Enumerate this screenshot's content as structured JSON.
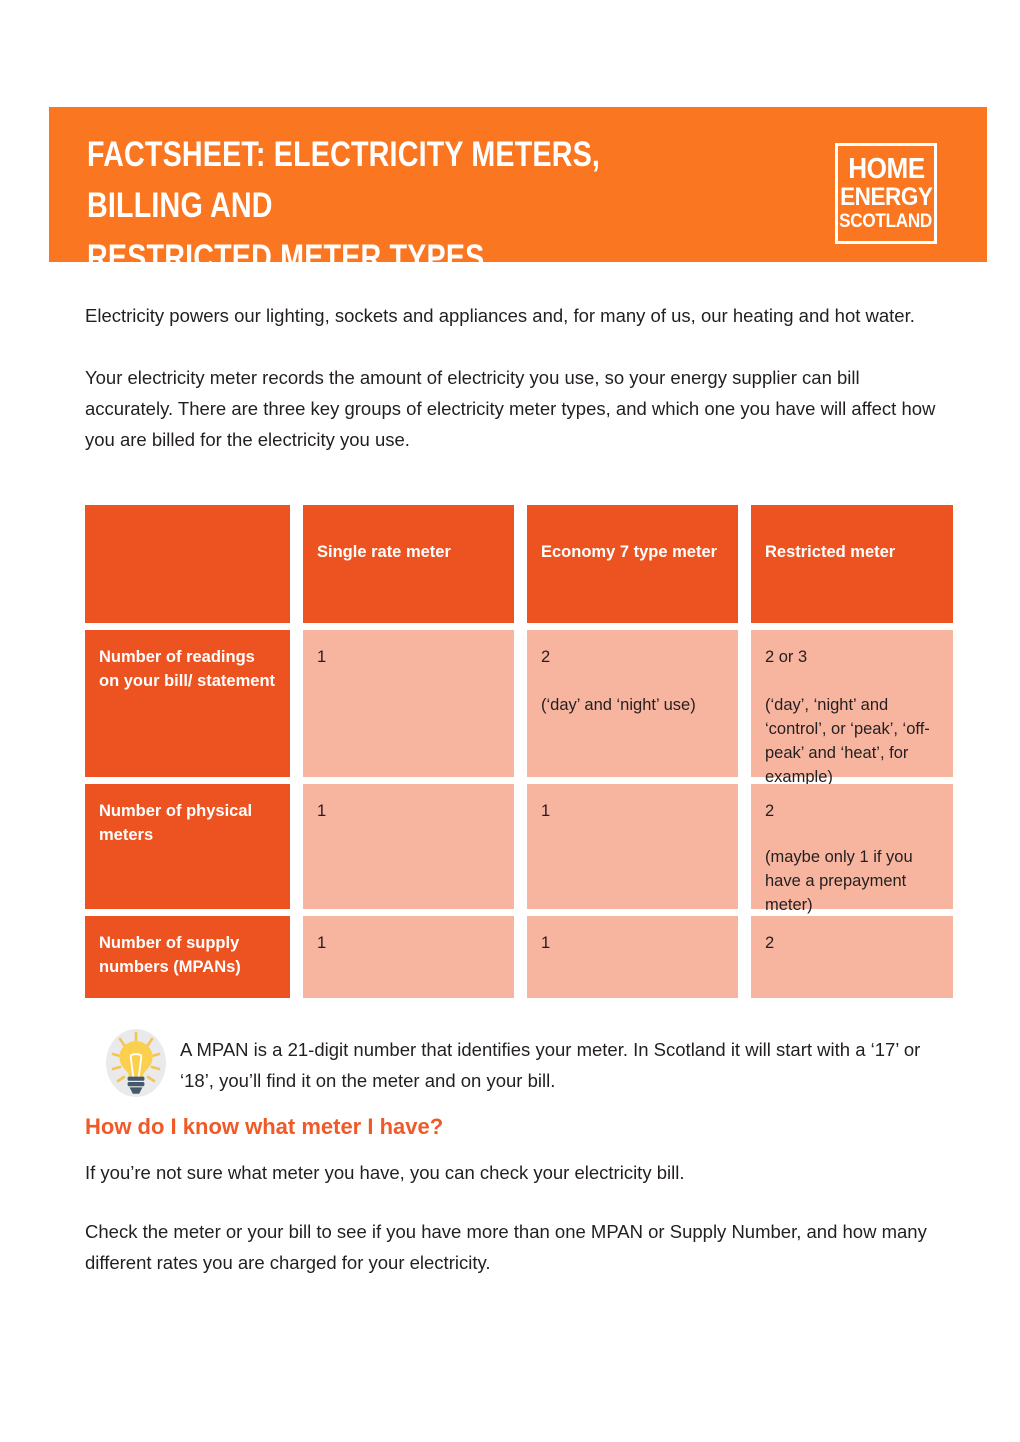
{
  "header": {
    "title": "FACTSHEET: ELECTRICITY METERS, BILLING AND\nRESTRICTED METER TYPES",
    "logo": {
      "line1": "HOME",
      "line2": "ENERGY",
      "line3": "SCOTLAND"
    },
    "background_color": "#FA7620"
  },
  "intro": {
    "paragraph1": "Electricity powers our lighting, sockets and appliances and, for many of us, our heating and hot water.",
    "paragraph2": "Your electricity meter records the amount of electricity you use, so your energy supplier can bill accurately. There are three key groups of electricity meter types, and which one you have will affect how you are billed for the electricity you use."
  },
  "table": {
    "header_color": "#ED5320",
    "cell_color": "#F7B5A0",
    "columns": [
      "",
      "Single rate meter",
      "Economy 7 type meter",
      "Restricted meter"
    ],
    "rows": [
      {
        "label": "Number of readings on your bill/ statement",
        "single_rate": "1",
        "single_rate_note": "",
        "economy7": "2",
        "economy7_note": "(‘day’ and ‘night’ use)",
        "restricted": "2 or 3",
        "restricted_note": "(‘day’, ‘night’ and ‘control’, or ‘peak’, ‘off-peak’ and ‘heat’, for example)"
      },
      {
        "label": "Number of physical meters",
        "single_rate": "1",
        "single_rate_note": "",
        "economy7": "1",
        "economy7_note": "",
        "restricted": "2",
        "restricted_note": "(maybe only 1 if you have a prepayment meter)"
      },
      {
        "label": "Number of supply numbers (MPANs)",
        "single_rate": "1",
        "single_rate_note": "",
        "economy7": "1",
        "economy7_note": "",
        "restricted": "2",
        "restricted_note": ""
      }
    ]
  },
  "tip": {
    "icon": "lightbulb-icon",
    "text": "A MPAN is a 21-digit number that identifies your meter. In Scotland it will start with a ‘17’ or ‘18’, you’ll find it on the meter and on your bill."
  },
  "section": {
    "heading": "How do I know what meter I have?",
    "heading_color": "#EF5A28",
    "paragraph1": "If you’re not sure what meter you have, you can check your electricity bill.",
    "paragraph2": "Check the meter or your bill to see if you have more than one MPAN or Supply Number, and how many different rates you are charged for your electricity."
  }
}
